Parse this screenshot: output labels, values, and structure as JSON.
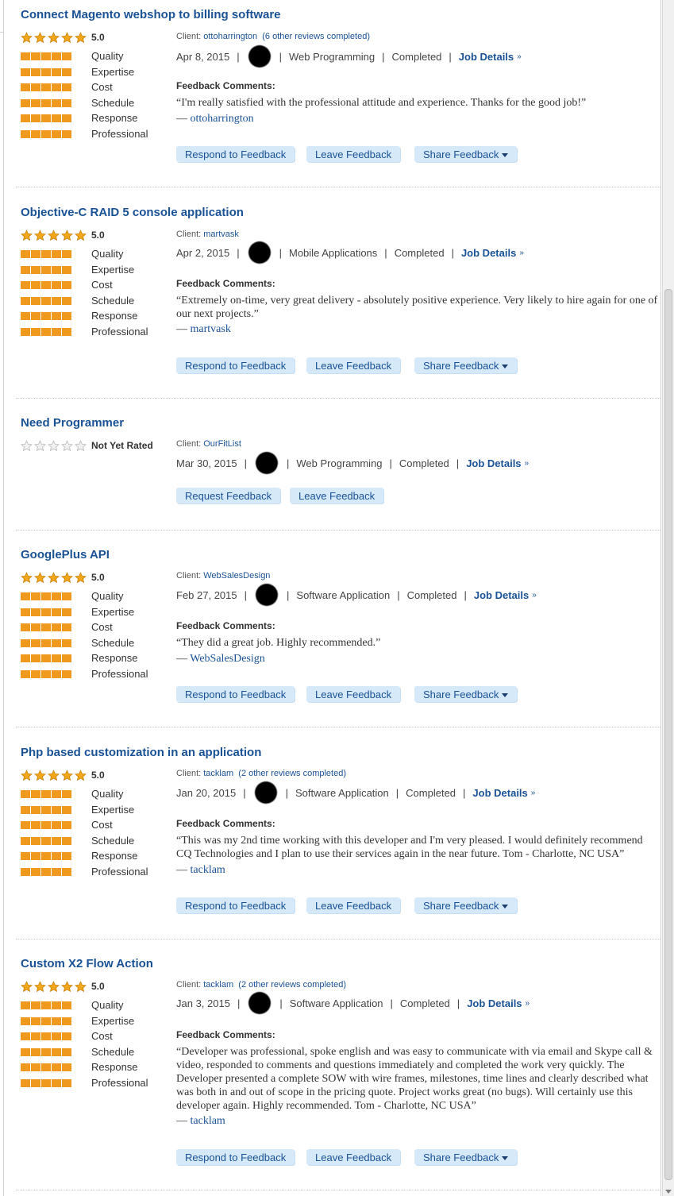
{
  "labels": {
    "client": "Client:",
    "feedback_comments": "Feedback Comments:",
    "job_details": "Job Details",
    "respond": "Respond to Feedback",
    "leave": "Leave Feedback",
    "share": "Share Feedback",
    "request": "Request Feedback",
    "not_rated": "Not Yet Rated"
  },
  "categories": [
    "Quality",
    "Expertise",
    "Cost",
    "Schedule",
    "Response",
    "Professional"
  ],
  "colors": {
    "link": "#1a5296",
    "bar": "#ef9a1f",
    "button_bg": "#d6e9f8"
  },
  "reviews": [
    {
      "title": "Connect Magento webshop to billing software",
      "score": "5.0",
      "client": "ottoharrington",
      "other_reviews": "(6 other reviews completed)",
      "date": "Apr 8, 2015",
      "category": "Web Programming",
      "status": "Completed",
      "comment": "“I'm really satisfied with the professional attitude and experience. Thanks for the good job!”",
      "author_prefix": "— ",
      "author": "ottoharrington"
    },
    {
      "title": "Objective-C RAID 5 console application",
      "score": "5.0",
      "client": "martvask",
      "date": "Apr 2, 2015",
      "category": "Mobile Applications",
      "status": "Completed",
      "comment": "“Extremely on-time, very great delivery - absolutely positive experience. Very likely to hire again for one of our next projects.”",
      "author_prefix": "— ",
      "author": "martvask"
    },
    {
      "title": "Need Programmer",
      "client": "OurFitList",
      "date": "Mar 30, 2015",
      "category": "Web Programming",
      "status": "Completed"
    },
    {
      "title": "GooglePlus API",
      "score": "5.0",
      "client": "WebSalesDesign",
      "date": "Feb 27, 2015",
      "category": "Software Application",
      "status": "Completed",
      "comment": "“They did a great job. Highly recommended.”",
      "author_prefix": "— ",
      "author": "WebSalesDesign"
    },
    {
      "title": "Php based customization in an application",
      "score": "5.0",
      "client": "tacklam",
      "other_reviews": "(2 other reviews completed)",
      "date": "Jan 20, 2015",
      "category": "Software Application",
      "status": "Completed",
      "comment": "“This was my 2nd time working with this developer and I'm very pleased. I would definitely recommend CQ Technologies and I plan to use their services again in the near future. Tom - Charlotte, NC USA”",
      "author_prefix": "— ",
      "author": "tacklam"
    },
    {
      "title": "Custom X2 Flow Action",
      "score": "5.0",
      "client": "tacklam",
      "other_reviews": "(2 other reviews completed)",
      "date": "Jan 3, 2015",
      "category": "Software Application",
      "status": "Completed",
      "comment": "“Developer was professional, spoke english and was easy to communicate with via email and Skype call & video, responded to comments and questions immediately and completed the work very quickly. The Developer presented a complete SOW with wire frames, milestones, time lines and clearly described what was both in and out of scope in the pricing quote. Project works great (no bugs). Will certainly use this developer again. Highly recommended. Tom - Charlotte, NC USA”",
      "author_prefix": "— ",
      "author": "tacklam"
    }
  ]
}
